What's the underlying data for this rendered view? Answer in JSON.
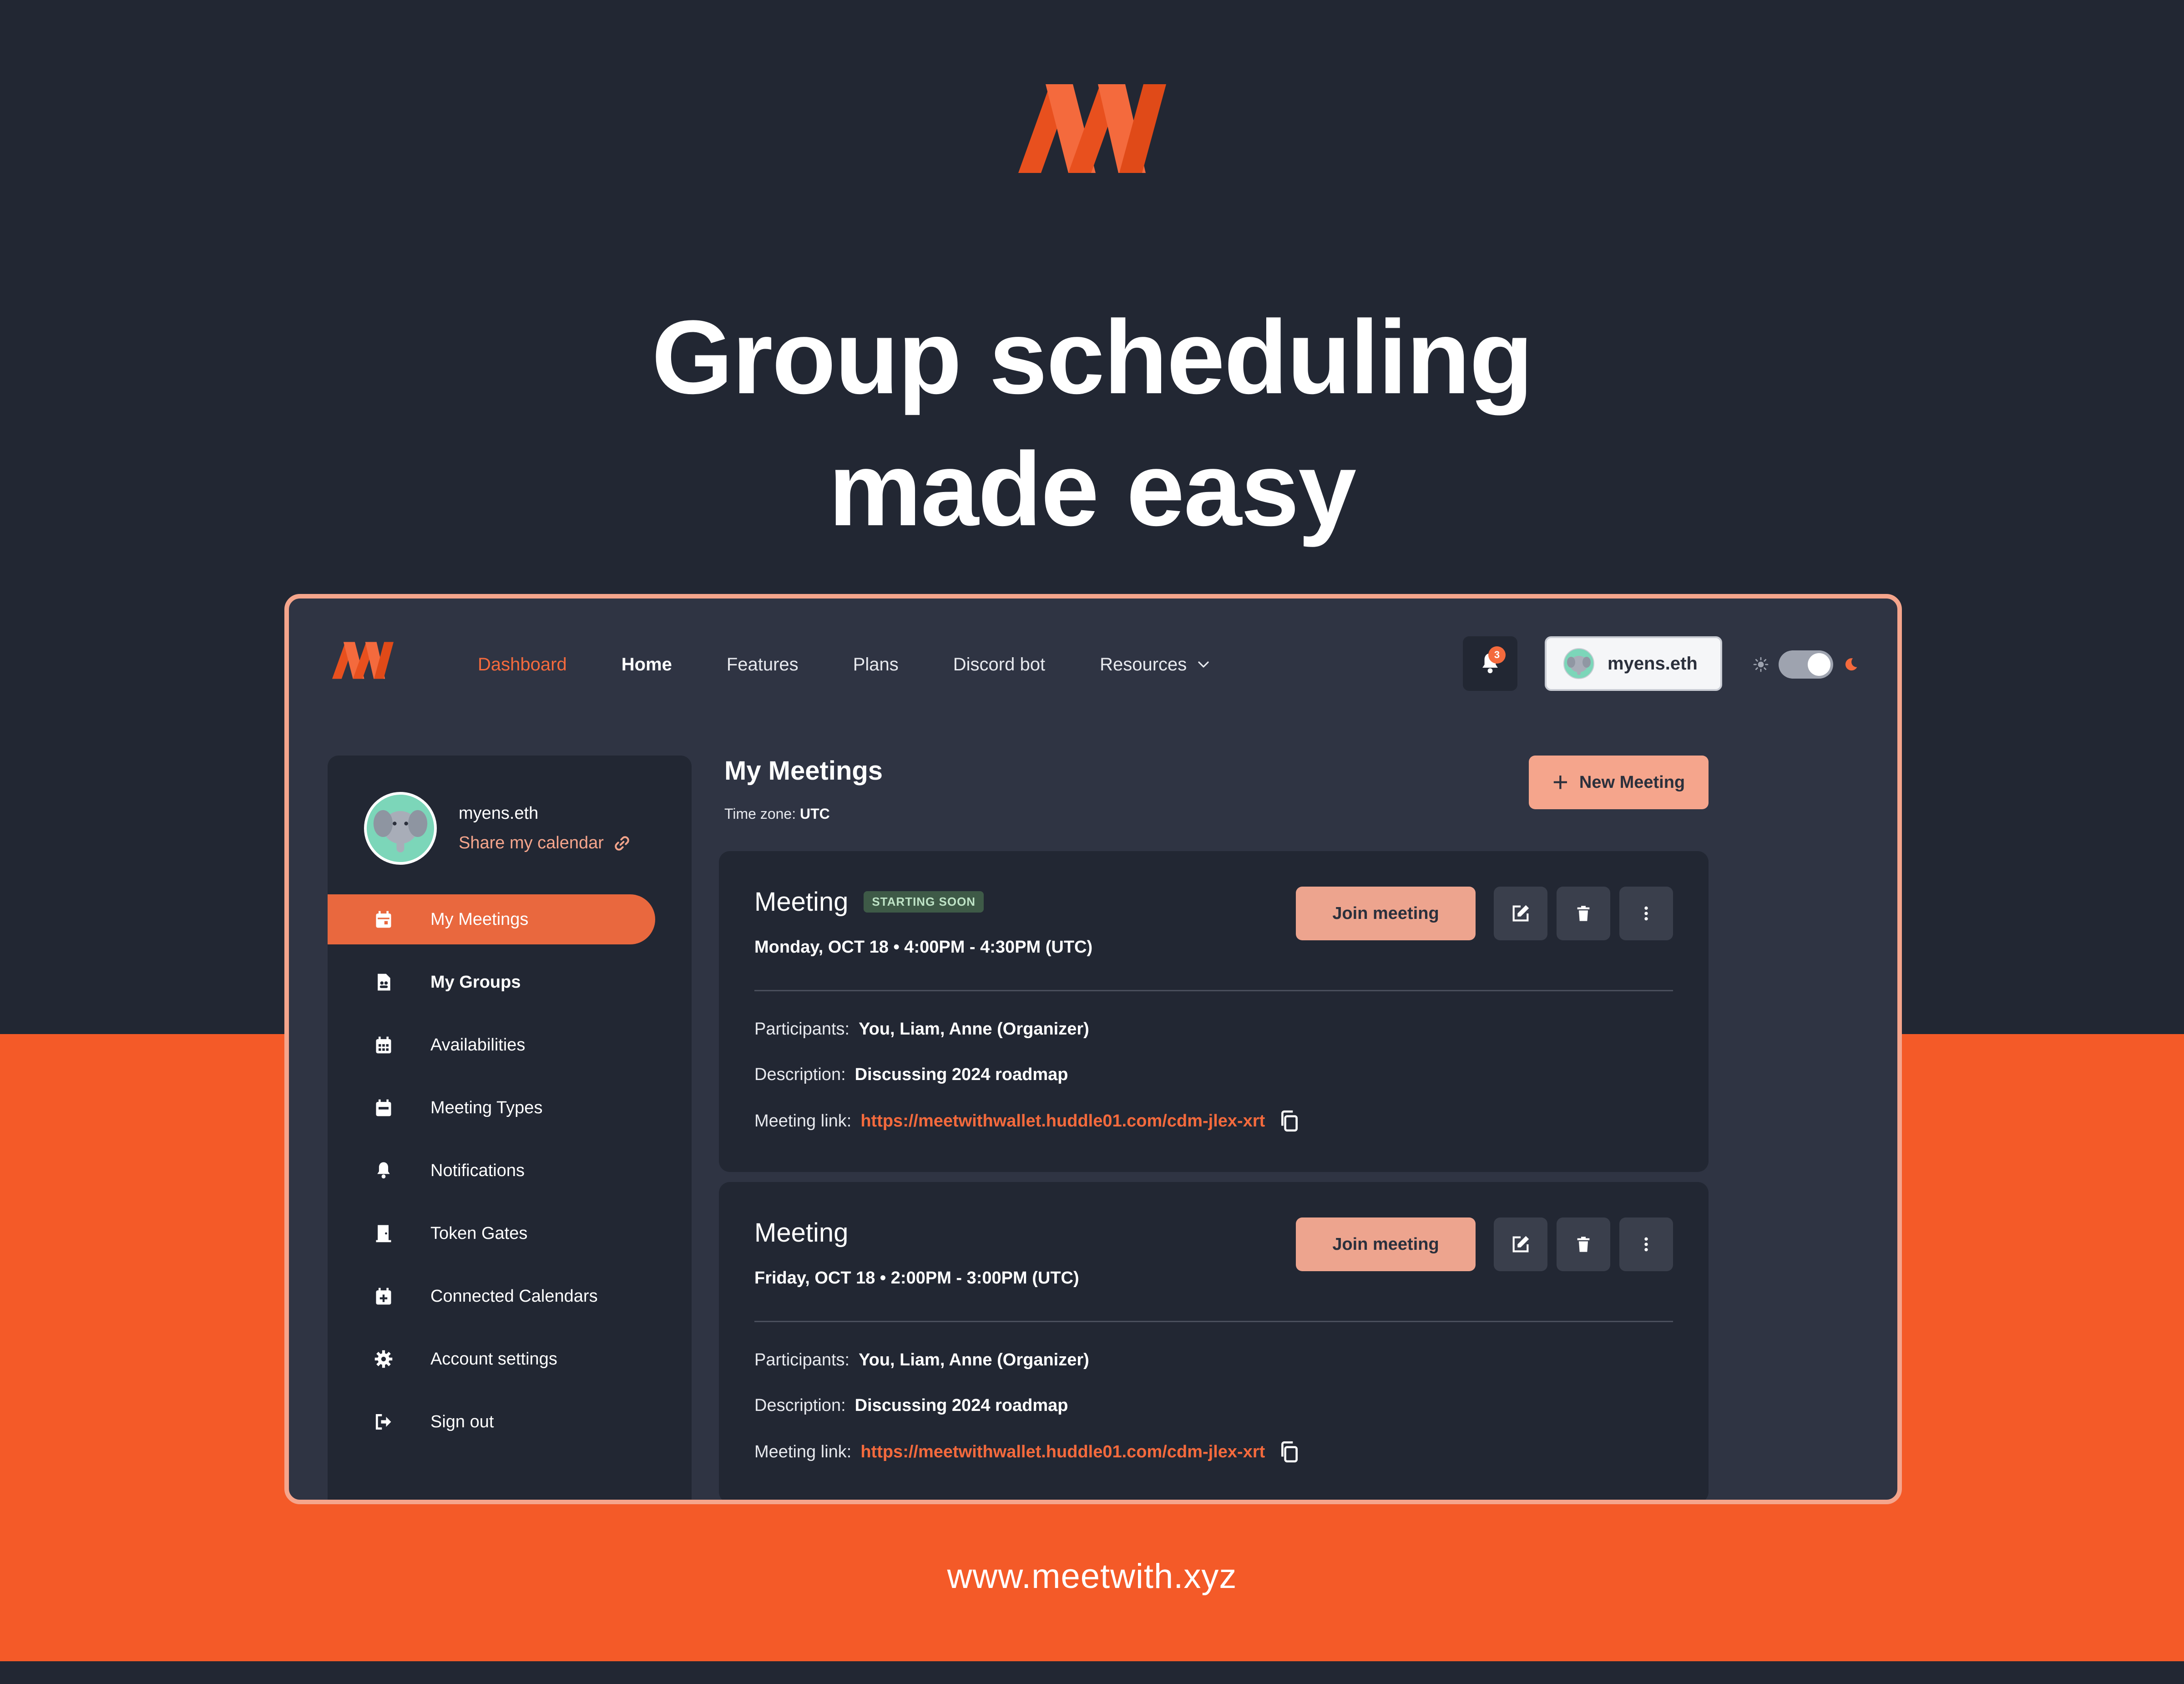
{
  "hero": {
    "title_line1": "Group scheduling",
    "title_line2": "made easy",
    "url": "www.meetwith.xyz"
  },
  "colors": {
    "accent": "#F45A28",
    "accent_soft": "#F5A58C",
    "dark_bg": "#222733",
    "panel_bg": "#2F3443"
  },
  "nav": {
    "items": [
      {
        "label": "Dashboard",
        "state": "active"
      },
      {
        "label": "Home",
        "state": "bold"
      },
      {
        "label": "Features"
      },
      {
        "label": "Plans"
      },
      {
        "label": "Discord bot"
      },
      {
        "label": "Resources",
        "icon": "chevron-down-icon"
      }
    ],
    "notification_count": "3",
    "user_name": "myens.eth",
    "theme_toggle": {
      "left_icon": "sun-icon",
      "right_icon": "moon-icon",
      "mode": "dark"
    }
  },
  "sidebar": {
    "profile_name": "myens.eth",
    "share_label": "Share my calendar",
    "items": [
      {
        "label": "My Meetings",
        "icon": "calendar-icon",
        "active": true
      },
      {
        "label": "My Groups",
        "icon": "group-file-icon"
      },
      {
        "label": "Availabilities",
        "icon": "calendar-grid-icon"
      },
      {
        "label": "Meeting Types",
        "icon": "calendar-type-icon"
      },
      {
        "label": "Notifications",
        "icon": "bell-icon"
      },
      {
        "label": "Token Gates",
        "icon": "door-icon"
      },
      {
        "label": "Connected Calendars",
        "icon": "calendar-plus-icon"
      },
      {
        "label": "Account settings",
        "icon": "gear-icon"
      },
      {
        "label": "Sign out",
        "icon": "sign-out-icon"
      }
    ]
  },
  "main": {
    "title": "My Meetings",
    "timezone_label": "Time zone:",
    "timezone_value": "UTC",
    "new_meeting_label": "New Meeting",
    "meetings": [
      {
        "title": "Meeting",
        "badge": "STARTING SOON",
        "date": "Monday, OCT 18 • 4:00PM - 4:30PM (UTC)",
        "join_label": "Join meeting",
        "participants_label": "Participants:",
        "participants": "You, Liam, Anne (Organizer)",
        "description_label": "Description:",
        "description": "Discussing 2024 roadmap",
        "link_label": "Meeting link:",
        "link": "https://meetwithwallet.huddle01.com/cdm-jlex-xrt"
      },
      {
        "title": "Meeting",
        "date": "Friday, OCT 18 • 2:00PM - 3:00PM (UTC)",
        "join_label": "Join meeting",
        "participants_label": "Participants:",
        "participants": "You, Liam, Anne (Organizer)",
        "description_label": "Description:",
        "description": "Discussing 2024 roadmap",
        "link_label": "Meeting link:",
        "link": "https://meetwithwallet.huddle01.com/cdm-jlex-xrt"
      }
    ]
  }
}
